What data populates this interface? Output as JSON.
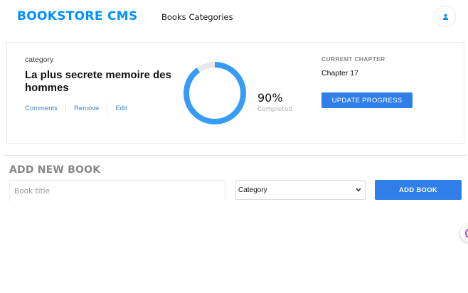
{
  "header": {
    "logo": "BOOKSTORE CMS",
    "nav": [
      "Books",
      "Categories"
    ],
    "avatar_icon": "user-icon",
    "accent_color": "#0290ff"
  },
  "book": {
    "category": "category",
    "title": "La plus secrete memoire des hommes",
    "actions": {
      "comments": "Comments",
      "remove": "Remove",
      "edit": "Edit"
    },
    "progress_percent": 90,
    "progress_text": "90%",
    "progress_label": "Completed",
    "current_chapter_heading": "CURRENT CHAPTER",
    "current_chapter": "Chapter 17",
    "update_button": "UPDATE PROGRESS",
    "ring_color": "#379cf6",
    "ring_track_color": "#e8e8e8"
  },
  "add_book": {
    "heading": "ADD NEW BOOK",
    "title_placeholder": "Book title",
    "title_value": "",
    "category_selected": "Category",
    "add_button": "ADD BOOK",
    "button_color": "#307ee8"
  },
  "floating_widget_icon": "chat-widget-icon"
}
